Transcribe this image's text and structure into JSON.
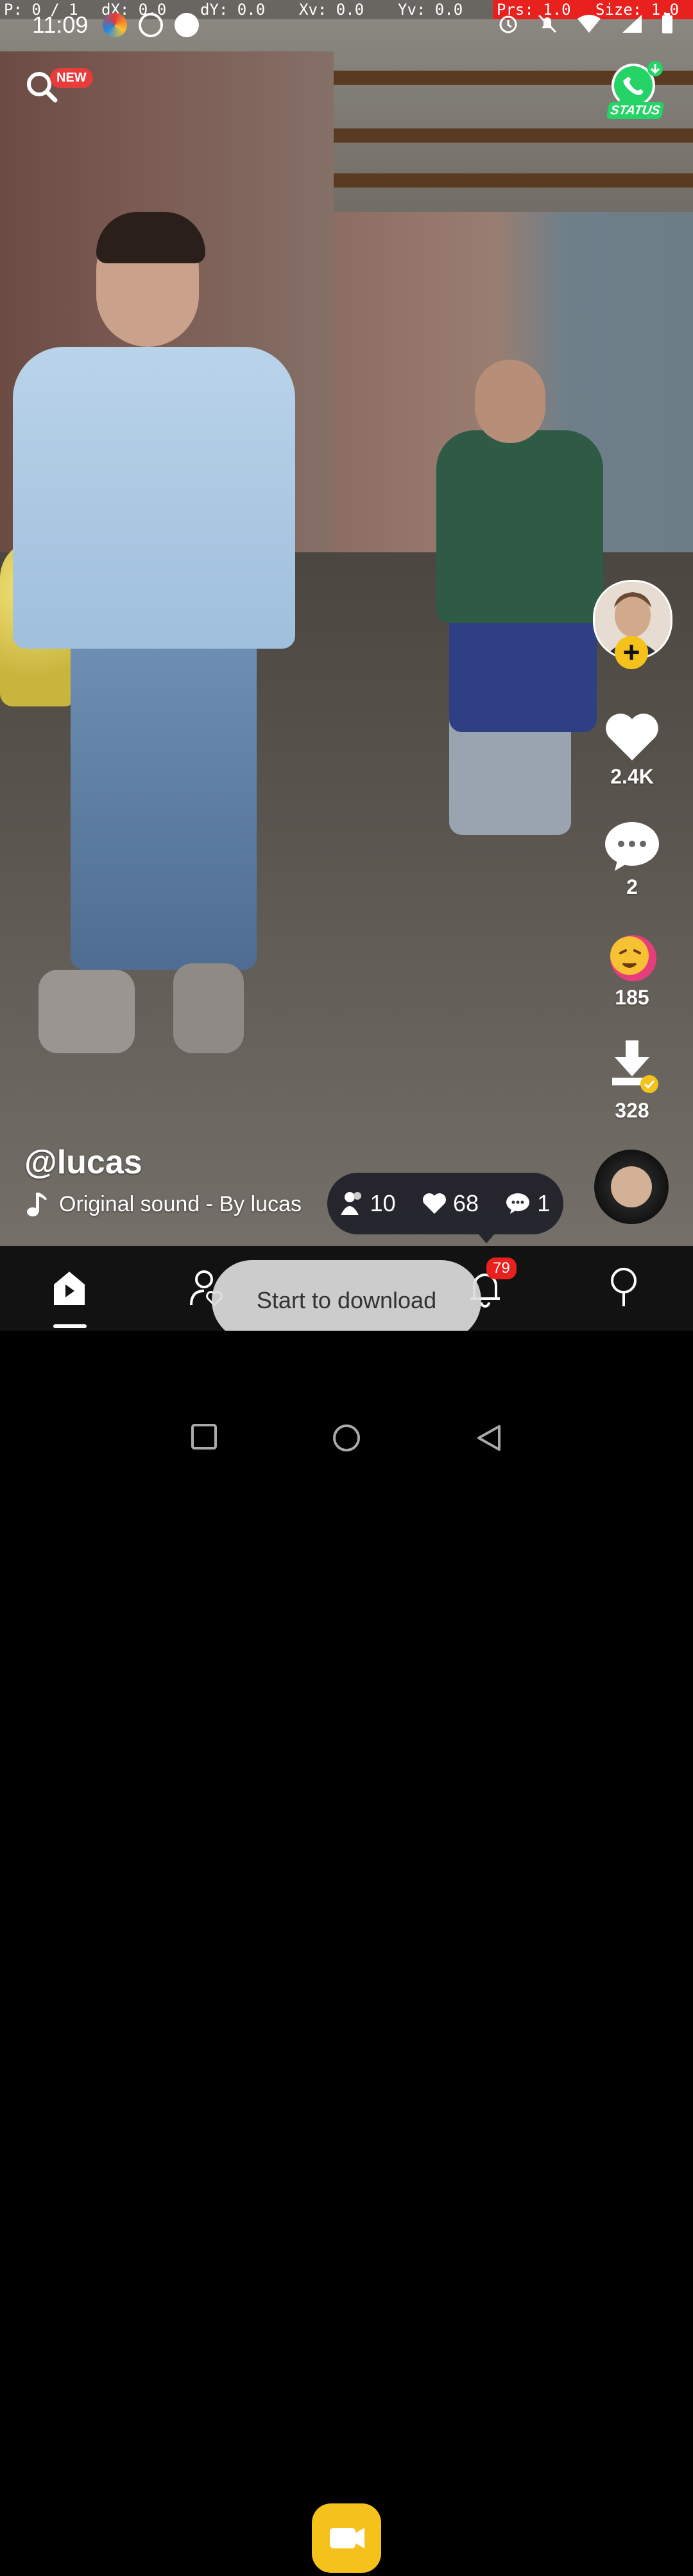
{
  "debug": {
    "pointer": "P: 0 / 1",
    "dx": "dX: 0.0",
    "dy": "dY: 0.0",
    "xv": "Xv: 0.0",
    "yv": "Yv: 0.0",
    "prs": "Prs: 1.0",
    "size": "Size: 1.0"
  },
  "status_bar": {
    "time": "11:09"
  },
  "top": {
    "new_badge": "NEW",
    "whatsapp_status": "STATUS"
  },
  "rail": {
    "likes": "2.4K",
    "comments": "2",
    "reactions": "185",
    "downloads": "328"
  },
  "post": {
    "username": "@lucas",
    "sound": "Original sound - By lucas"
  },
  "stats": {
    "views": "10",
    "likes": "68",
    "comments": "1"
  },
  "nav": {
    "notification_badge": "79"
  },
  "toast": {
    "text": "Start to download"
  },
  "colors": {
    "accent": "#f4c21a",
    "badge_red": "#e83b3b",
    "nav_bg": "#121212"
  }
}
